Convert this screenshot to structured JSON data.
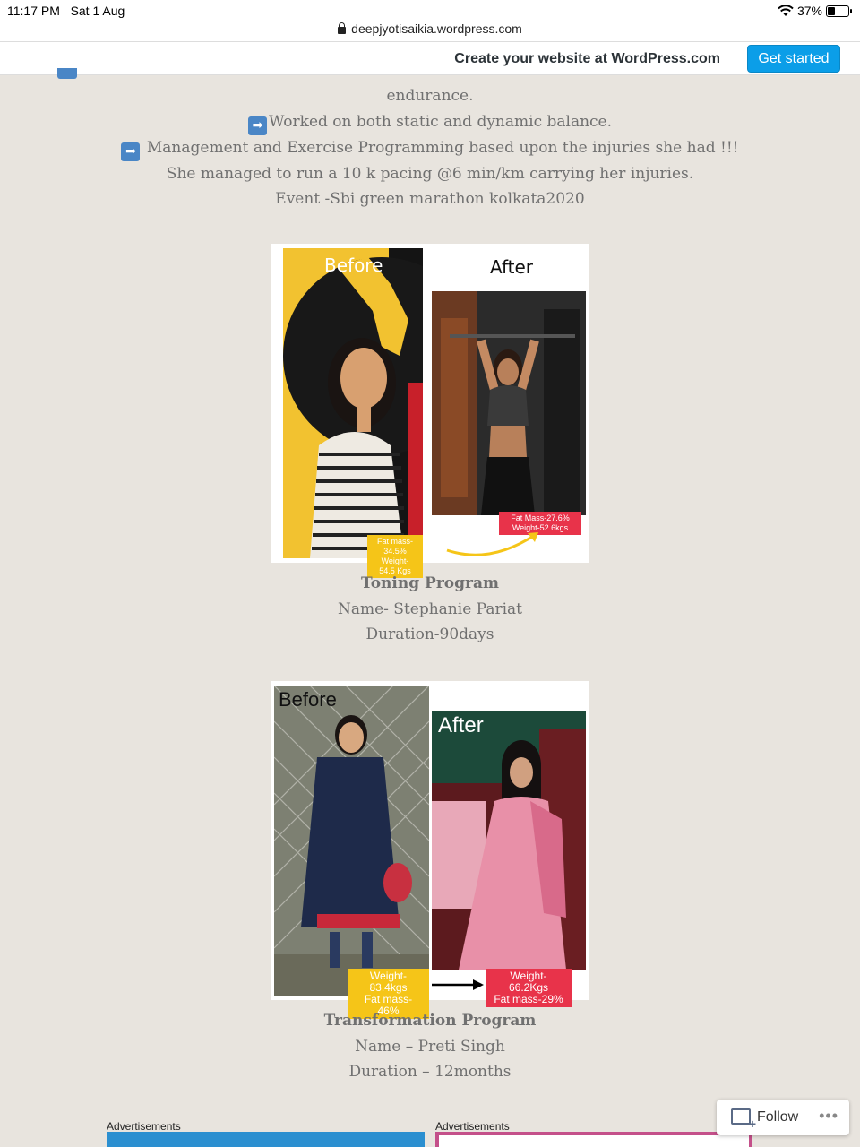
{
  "status": {
    "time": "11:17 PM",
    "date": "Sat 1 Aug",
    "battery": "37%",
    "battery_level": 0.37
  },
  "url": "deepjyotisaikia.wordpress.com",
  "banner": {
    "create_text": "Create your website at WordPress.com",
    "cta_label": "Get started"
  },
  "intro": {
    "line_endurance": "endurance.",
    "line_balance": "Worked on both static and dynamic balance.",
    "line_management": " Management and Exercise Programming based upon the injuries she had !!!",
    "line_run": "She managed to run a 10 k pacing @6 min/km carrying her injuries.",
    "line_event": "Event -Sbi green marathon kolkata2020",
    "arrow_glyph": "➡"
  },
  "toning": {
    "before_label": "Before",
    "after_label": "After",
    "before_stats": [
      "Fat mass-34.5%",
      "Weight-54.5 Kgs"
    ],
    "after_stats": [
      "Fat Mass-27.6%",
      "Weight-52.6kgs"
    ],
    "title": "Toning Program",
    "name": "Name- Stephanie Pariat",
    "duration": "Duration-90days"
  },
  "transformation": {
    "before_label": "Before",
    "after_label": "After",
    "before_stats": [
      "Weight-83.4kgs",
      "Fat mass-46%"
    ],
    "after_stats": [
      "Weight-66.2Kgs",
      "Fat mass-29%"
    ],
    "title": "Transformation Program",
    "name": "Name – Preti Singh",
    "duration": "Duration – 12months"
  },
  "ads": {
    "left_label": "Advertisements",
    "right_label": "Advertisements"
  },
  "follow": {
    "label": "Follow",
    "more": "•••"
  },
  "colors": {
    "yellow_tag": "#f5c518",
    "red_tag": "#e8334a",
    "wp_blue": "#0b9ee8",
    "ad_blue": "#2b8fd0",
    "ad_pink": "#c4508a"
  }
}
